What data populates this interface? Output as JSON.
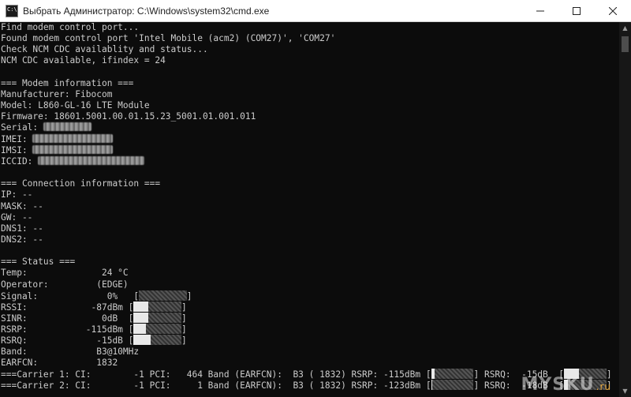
{
  "window": {
    "title": "Выбрать Администратор: C:\\Windows\\system32\\cmd.exe",
    "icon": "cmd-icon",
    "icon_text": "C:\\"
  },
  "console": {
    "lines": [
      [
        "Find modem control port..."
      ],
      [
        "Found modem control port 'Intel Mobile (acm2) (COM27)', 'COM27'"
      ],
      [
        "Check NCM CDC availablity and status..."
      ],
      [
        "NCM CDC available, ifindex = 24"
      ],
      [
        ""
      ],
      [
        "=== Modem information ==="
      ],
      [
        "Manufacturer: Fibocom"
      ],
      [
        "Model: L860-GL-16 LTE Module"
      ],
      [
        "Firmware: 18601.5001.00.01.15.23_5001.01.001.011"
      ],
      [
        "Serial: ",
        {
          "redacted": true,
          "chars": 9
        }
      ],
      [
        "IMEI: ",
        {
          "redacted": true,
          "chars": 15
        }
      ],
      [
        "IMSI: ",
        {
          "redacted": true,
          "chars": 15
        }
      ],
      [
        "ICCID: ",
        {
          "redacted": true,
          "chars": 20
        }
      ],
      [
        ""
      ],
      [
        "=== Connection information ==="
      ],
      [
        "IP: --"
      ],
      [
        "MASK: --"
      ],
      [
        "GW: --"
      ],
      [
        "DNS1: --"
      ],
      [
        "DNS2: --"
      ],
      [
        ""
      ],
      [
        "=== Status ==="
      ],
      [
        "Temp:              24 °C"
      ],
      [
        "Operator:         (EDGE)"
      ],
      [
        "Signal:             0%   [",
        {
          "bar": 0.0,
          "chars": 9
        },
        "]"
      ],
      [
        "RSSI:            -87dBm [",
        {
          "bar": 0.3,
          "chars": 9
        },
        "]"
      ],
      [
        "SINR:              0dB  [",
        {
          "bar": 0.3,
          "chars": 9
        },
        "]"
      ],
      [
        "RSRP:           -115dBm [",
        {
          "bar": 0.25,
          "chars": 9
        },
        "]"
      ],
      [
        "RSRQ:             -15dB [",
        {
          "bar": 0.35,
          "chars": 9
        },
        "]"
      ],
      [
        "Band:             B3@10MHz"
      ],
      [
        "EARFCN:           1832"
      ],
      [
        "===Carrier 1: CI:        -1 PCI:   464 Band (EARFCN):  B3 ( 1832) RSRP: -115dBm [",
        {
          "bar": 0.08,
          "chars": 8
        },
        "] RSRQ:  -15dB  [",
        {
          "bar": 0.35,
          "chars": 8
        },
        "]"
      ],
      [
        "===Carrier 2: CI:        -1 PCI:     1 Band (EARFCN):  B3 ( 1832) RSRP: -123dBm [",
        {
          "bar": 0.03,
          "chars": 8
        },
        "] RSRQ:  -18dB  [",
        {
          "bar": 0.1,
          "chars": 8
        },
        "]"
      ]
    ]
  },
  "watermark": {
    "text": "MYSKU",
    "tld": ".ru"
  },
  "colors": {
    "console_bg": "#0c0c0c",
    "console_fg": "#cccccc",
    "titlebar_bg": "#ffffff"
  }
}
